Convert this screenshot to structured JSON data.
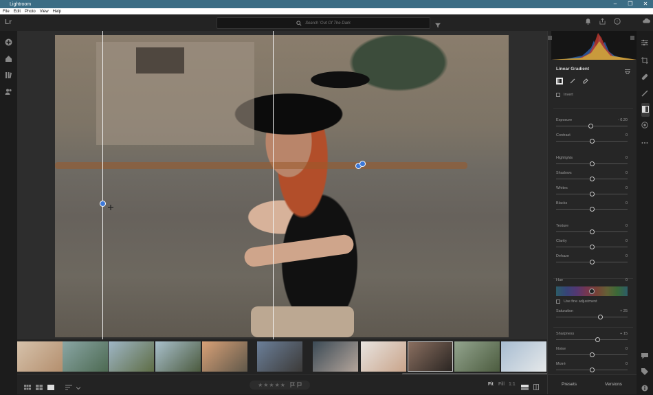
{
  "window": {
    "title": "Lightroom",
    "buttons": [
      "–",
      "❐",
      "✕"
    ]
  },
  "menu": [
    "File",
    "Edit",
    "Photo",
    "View",
    "Help"
  ],
  "header": {
    "logo": "Lr",
    "search_placeholder": "Search 'Out Of The Dark"
  },
  "panel": {
    "title": "Linear Gradient",
    "invert_label": "Invert",
    "sliders": [
      {
        "label": "Exposure",
        "value": "- 0.20",
        "pos": 0.48
      },
      {
        "label": "Contrast",
        "value": "0",
        "pos": 0.5
      },
      {
        "label": "Highlights",
        "value": "0",
        "pos": 0.5
      },
      {
        "label": "Shadows",
        "value": "0",
        "pos": 0.5
      },
      {
        "label": "Whites",
        "value": "0",
        "pos": 0.5
      },
      {
        "label": "Blacks",
        "value": "0",
        "pos": 0.5
      },
      {
        "label": "Texture",
        "value": "0",
        "pos": 0.5
      },
      {
        "label": "Clarity",
        "value": "0",
        "pos": 0.5
      },
      {
        "label": "Dehaze",
        "value": "0",
        "pos": 0.5
      }
    ],
    "hue": {
      "label": "Hue",
      "value": "0",
      "pos": 0.5
    },
    "fine_adjustment_label": "Use fine adjustment",
    "sliders2": [
      {
        "label": "Saturation",
        "value": "+ 25",
        "pos": 0.62
      }
    ],
    "sliders3": [
      {
        "label": "Sharpness",
        "value": "+ 15",
        "pos": 0.58
      },
      {
        "label": "Noise",
        "value": "0",
        "pos": 0.5
      },
      {
        "label": "Moiré",
        "value": "0",
        "pos": 0.5
      }
    ],
    "footer": {
      "presets": "Presets",
      "versions": "Versions"
    }
  },
  "bottombar": {
    "stars": "★★★★★",
    "zoom": {
      "fit": "Fit",
      "fill": "Fill",
      "one": "1:1"
    }
  },
  "filmstrip_colors": [
    [
      "#d6c2ab",
      "#b48f6e"
    ],
    [
      "#8aa6a5",
      "#4d6a52"
    ],
    [
      "#9fb6c6",
      "#5e6d45"
    ],
    [
      "#a9c0cc",
      "#4b5a3e"
    ],
    [
      "#d8a177",
      "#60584a"
    ],
    [
      "#6b7f99",
      "#3c3a38"
    ],
    [
      "#3b4a55",
      "#b4a59b"
    ],
    [
      "#e8e4e0",
      "#c9a48a"
    ],
    [
      "#8a6f60",
      "#2a2522"
    ],
    [
      "#93a48e",
      "#4c5c3f"
    ],
    [
      "#a7bcd1",
      "#e6e9ea"
    ]
  ],
  "colors": {
    "accent": "#3b6d85",
    "pin": "#3c78d8"
  }
}
